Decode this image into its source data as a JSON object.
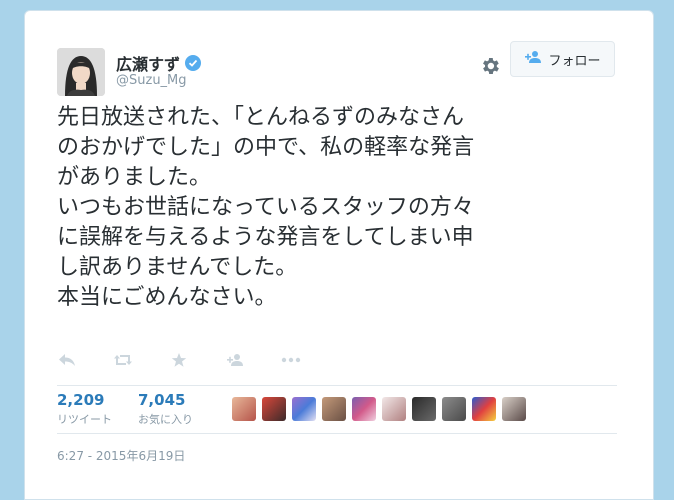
{
  "user": {
    "display_name": "広瀬すず",
    "handle": "@Suzu_Mg",
    "verified_icon": "verified-badge-icon"
  },
  "follow_button": {
    "label": "フォロー",
    "icon": "follow-user-icon"
  },
  "tweet": {
    "lines": [
      "先日放送された、「とんねるずのみなさん",
      "のおかげでした」の中で、私の軽率な発言",
      "がありました。",
      "いつもお世話になっているスタッフの方々",
      "に誤解を与えるような発言をしてしまい申",
      "し訳ありませんでした。",
      "本当にごめんなさい。"
    ]
  },
  "actions": [
    {
      "name": "reply-icon"
    },
    {
      "name": "retweet-icon"
    },
    {
      "name": "favorite-star-icon"
    },
    {
      "name": "follow-icon"
    },
    {
      "name": "more-icon"
    }
  ],
  "stats": {
    "retweets": {
      "count": "2,209",
      "label": "リツイート"
    },
    "favorites": {
      "count": "7,045",
      "label": "お気に入り"
    }
  },
  "timestamp": "6:27 - 2015年6月19日",
  "colors": {
    "accent": "#55acee",
    "link": "#2b7bb9",
    "text": "#292f33",
    "muted": "#8899a6",
    "background": "#a9d3ea"
  }
}
